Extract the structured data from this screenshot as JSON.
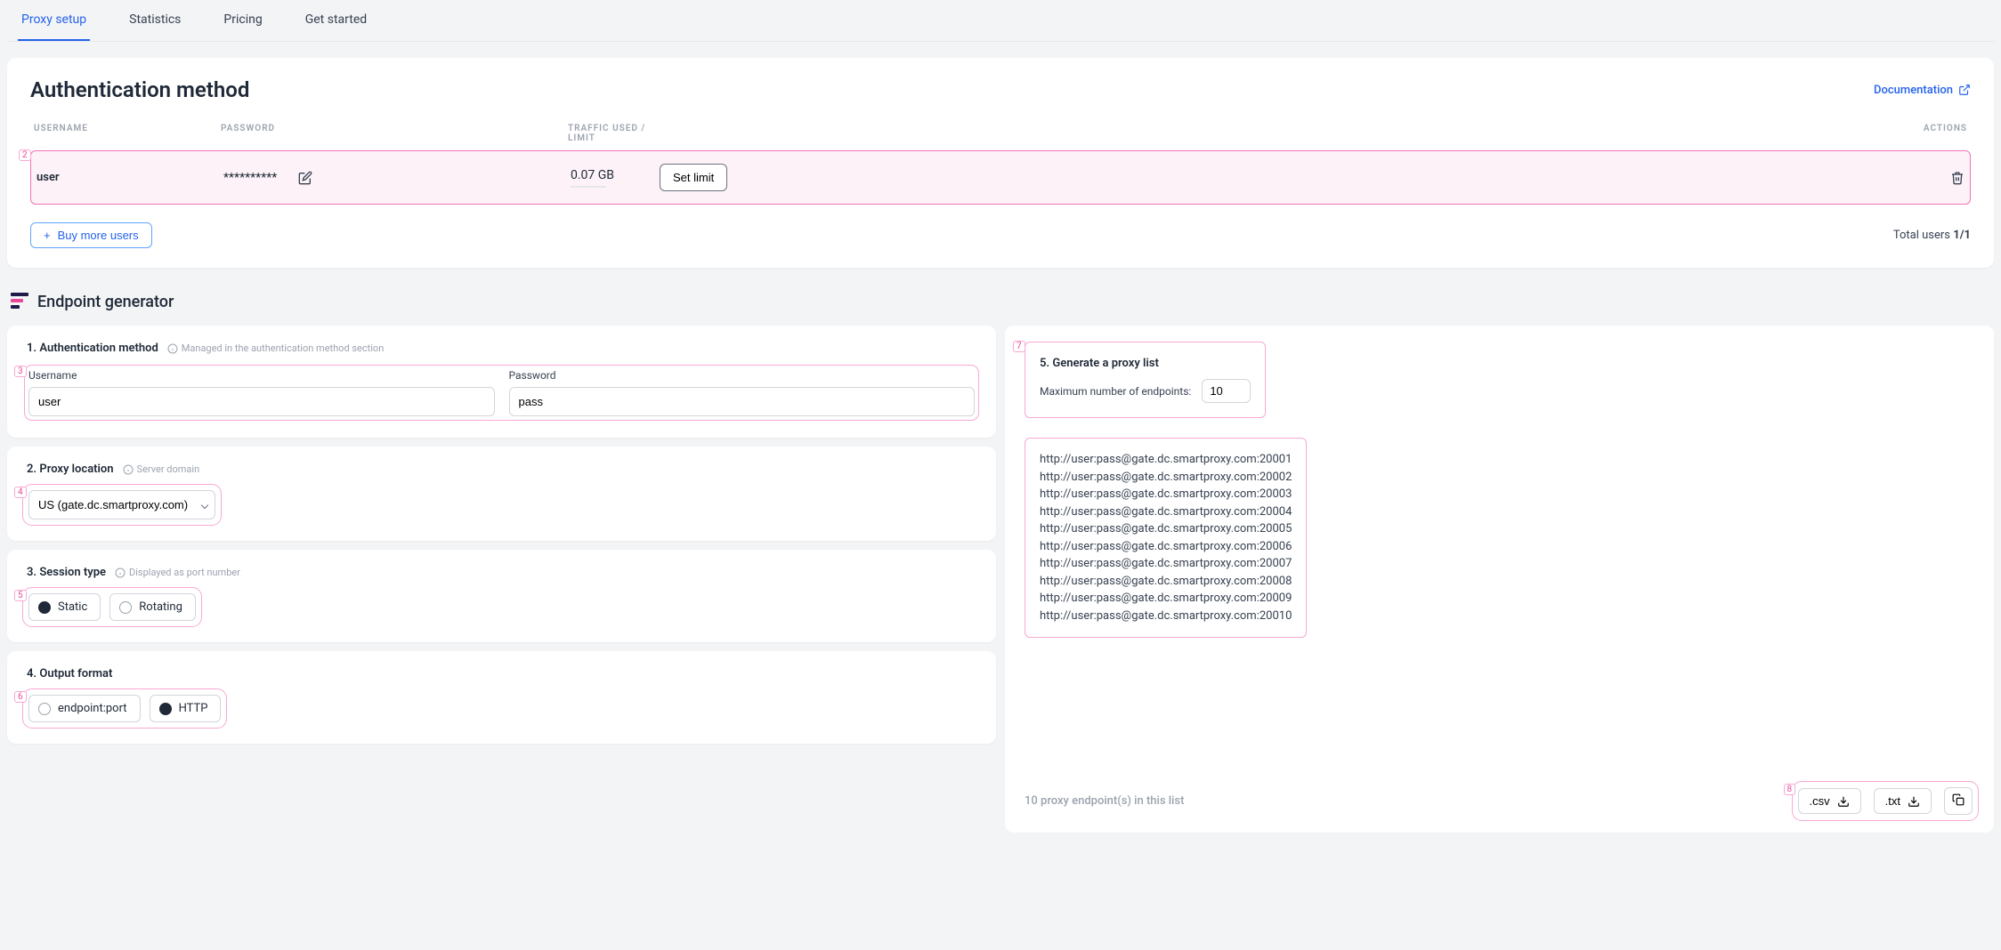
{
  "tabs": [
    "Proxy setup",
    "Statistics",
    "Pricing",
    "Get started"
  ],
  "auth_card": {
    "title": "Authentication method",
    "doc_link": "Documentation",
    "columns": {
      "username": "USERNAME",
      "password": "PASSWORD",
      "traffic": "TRAFFIC USED / LIMIT",
      "actions": "ACTIONS"
    },
    "row": {
      "username": "user",
      "password_masked": "**********",
      "usage": "0.07 GB",
      "set_limit": "Set limit"
    },
    "buy_more": "Buy more users",
    "total_prefix": "Total users ",
    "total_value": "1/1",
    "annot": "2"
  },
  "endpoint_section_title": "Endpoint generator",
  "step1": {
    "title": "1. Authentication method",
    "hint": "Managed in the authentication method section",
    "username_label": "Username",
    "password_label": "Password",
    "username_value": "user",
    "password_value": "pass",
    "annot": "3"
  },
  "step2": {
    "title": "2. Proxy location",
    "hint": "Server domain",
    "selected": "US (gate.dc.smartproxy.com)",
    "annot": "4"
  },
  "step3": {
    "title": "3. Session type",
    "hint": "Displayed as port number",
    "option_a": "Static",
    "option_b": "Rotating",
    "annot": "5"
  },
  "step4": {
    "title": "4. Output format",
    "option_a": "endpoint:port",
    "option_b": "HTTP",
    "annot": "6"
  },
  "step5": {
    "title": "5. Generate a proxy list",
    "max_label": "Maximum number of endpoints:",
    "max_value": "10",
    "annot": "7",
    "endpoints": [
      "http://user:pass@gate.dc.smartproxy.com:20001",
      "http://user:pass@gate.dc.smartproxy.com:20002",
      "http://user:pass@gate.dc.smartproxy.com:20003",
      "http://user:pass@gate.dc.smartproxy.com:20004",
      "http://user:pass@gate.dc.smartproxy.com:20005",
      "http://user:pass@gate.dc.smartproxy.com:20006",
      "http://user:pass@gate.dc.smartproxy.com:20007",
      "http://user:pass@gate.dc.smartproxy.com:20008",
      "http://user:pass@gate.dc.smartproxy.com:20009",
      "http://user:pass@gate.dc.smartproxy.com:20010"
    ],
    "footer_text": "10 proxy endpoint(s) in this list",
    "csv": ".csv",
    "txt": ".txt",
    "foot_annot": "8"
  }
}
